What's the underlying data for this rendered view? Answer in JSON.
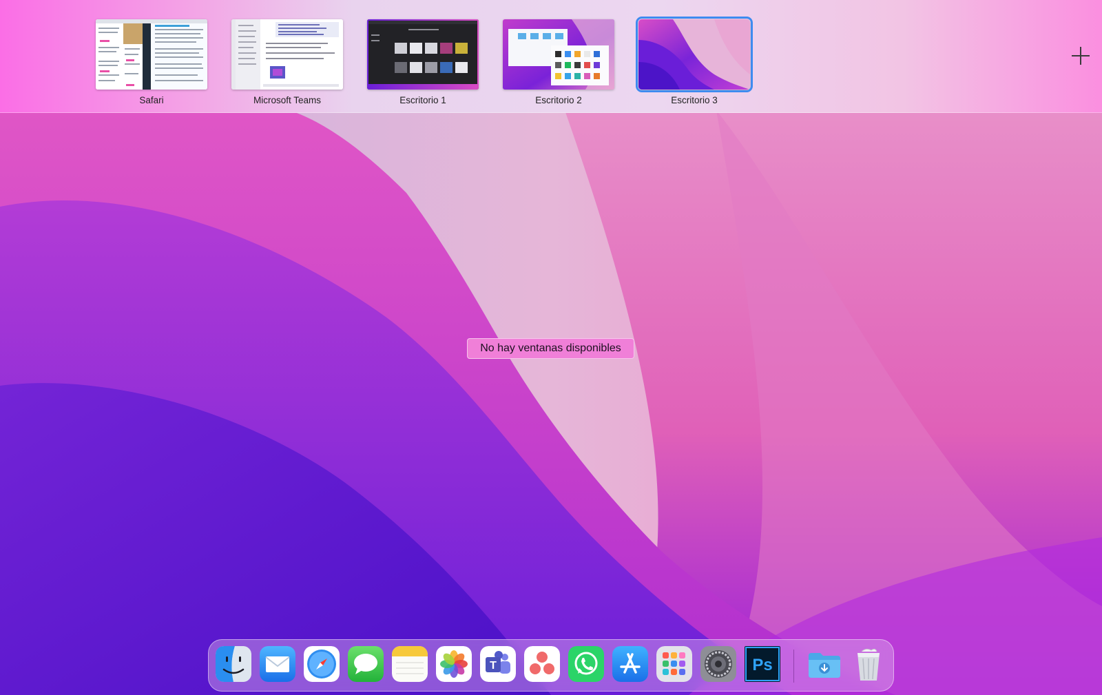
{
  "spaces": [
    {
      "label": "Safari",
      "active": false
    },
    {
      "label": "Microsoft Teams",
      "active": false
    },
    {
      "label": "Escritorio 1",
      "active": false
    },
    {
      "label": "Escritorio 2",
      "active": false
    },
    {
      "label": "Escritorio 3",
      "active": true
    }
  ],
  "message": "No hay ventanas disponibles",
  "dock": {
    "apps": [
      {
        "name": "finder-icon"
      },
      {
        "name": "mail-icon"
      },
      {
        "name": "safari-icon"
      },
      {
        "name": "messages-icon"
      },
      {
        "name": "notes-icon"
      },
      {
        "name": "photos-icon"
      },
      {
        "name": "teams-icon",
        "glyph": "T"
      },
      {
        "name": "asana-icon"
      },
      {
        "name": "whatsapp-icon"
      },
      {
        "name": "app-store-icon"
      },
      {
        "name": "launchpad-icon"
      },
      {
        "name": "system-preferences-icon"
      },
      {
        "name": "photoshop-icon",
        "glyph": "Ps"
      }
    ],
    "stack": [
      {
        "name": "downloads-folder-icon"
      },
      {
        "name": "trash-icon"
      }
    ]
  },
  "colors": {
    "accent": "#3e8bf0",
    "message_bg": "#f07fd8",
    "wallpaper_purple": "#6a1fd0",
    "wallpaper_magenta": "#d63fc3"
  }
}
